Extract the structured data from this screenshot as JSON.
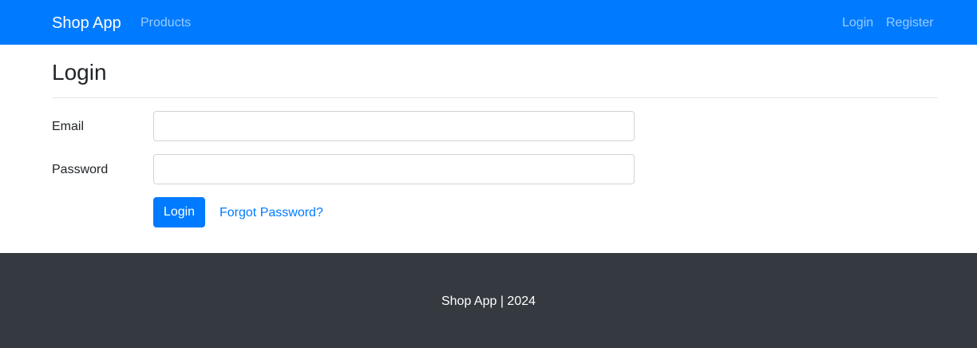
{
  "navbar": {
    "brand": "Shop App",
    "links": [
      {
        "label": "Products"
      },
      {
        "label": "Login"
      },
      {
        "label": "Register"
      }
    ],
    "background": "#007bff"
  },
  "main": {
    "title": "Login",
    "form": {
      "email_label": "Email",
      "email_value": "",
      "email_placeholder": "",
      "password_label": "Password",
      "password_value": "",
      "password_placeholder": "",
      "submit_label": "Login",
      "forgot_link": "Forgot Password?"
    }
  },
  "footer": {
    "text": "Shop App | 2024",
    "background": "#343a40"
  }
}
